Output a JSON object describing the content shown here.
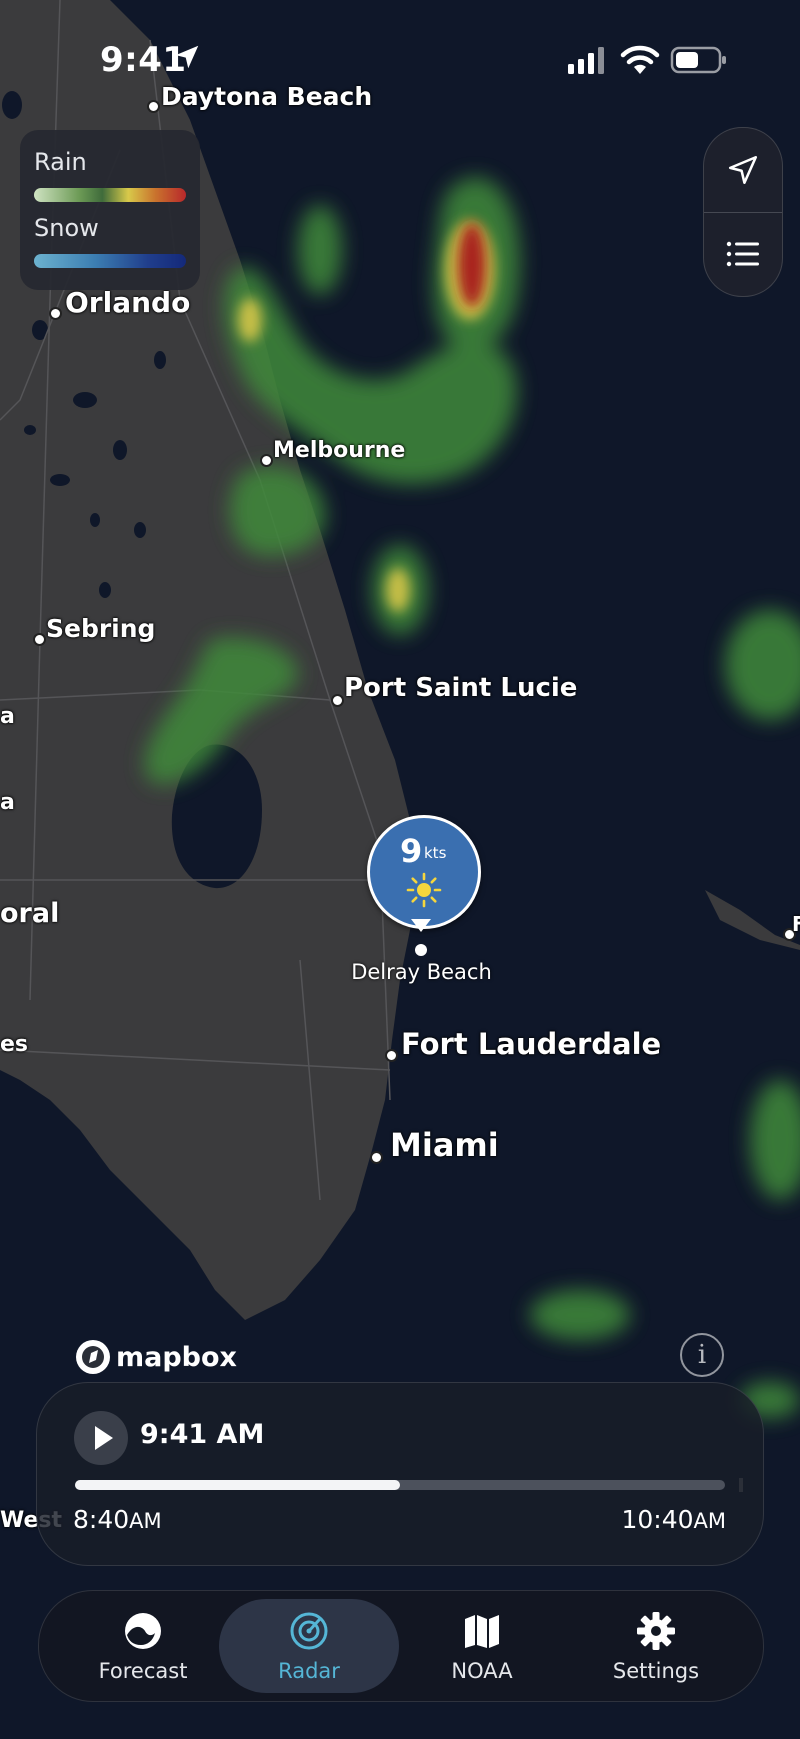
{
  "status_bar": {
    "time": "9:41"
  },
  "legend": {
    "rain_label": "Rain",
    "snow_label": "Snow"
  },
  "map": {
    "cities": {
      "daytona": "Daytona Beach",
      "orlando": "Orlando",
      "melbourne": "Melbourne",
      "sebring": "Sebring",
      "port_saint_lucie": "Port Saint Lucie",
      "fort_lauderdale": "Fort Lauderdale",
      "miami": "Miami",
      "left_partial_1": "a",
      "left_partial_2": "a",
      "left_partial_3": "oral",
      "left_partial_4": "es",
      "left_partial_5": "West",
      "right_partial": "F"
    },
    "attribution": "mapbox"
  },
  "wind_marker": {
    "value": "9",
    "unit": "kts",
    "location": "Delray Beach",
    "icon": "sun-icon"
  },
  "player": {
    "current_time": "9:41 AM",
    "start_time": "8:40",
    "start_ampm": "AM",
    "end_time": "10:40",
    "end_ampm": "AM",
    "progress": 0.5
  },
  "tabs": [
    {
      "label": "Forecast",
      "icon": "wave-icon",
      "active": false
    },
    {
      "label": "Radar",
      "icon": "radar-icon",
      "active": true
    },
    {
      "label": "NOAA",
      "icon": "map-icon",
      "active": false
    },
    {
      "label": "Settings",
      "icon": "gear-icon",
      "active": false
    }
  ],
  "colors": {
    "accent": "#55b6d6",
    "marker": "#3a6fb0",
    "ocean": "#0f1729",
    "land": "#3a3a3c"
  }
}
